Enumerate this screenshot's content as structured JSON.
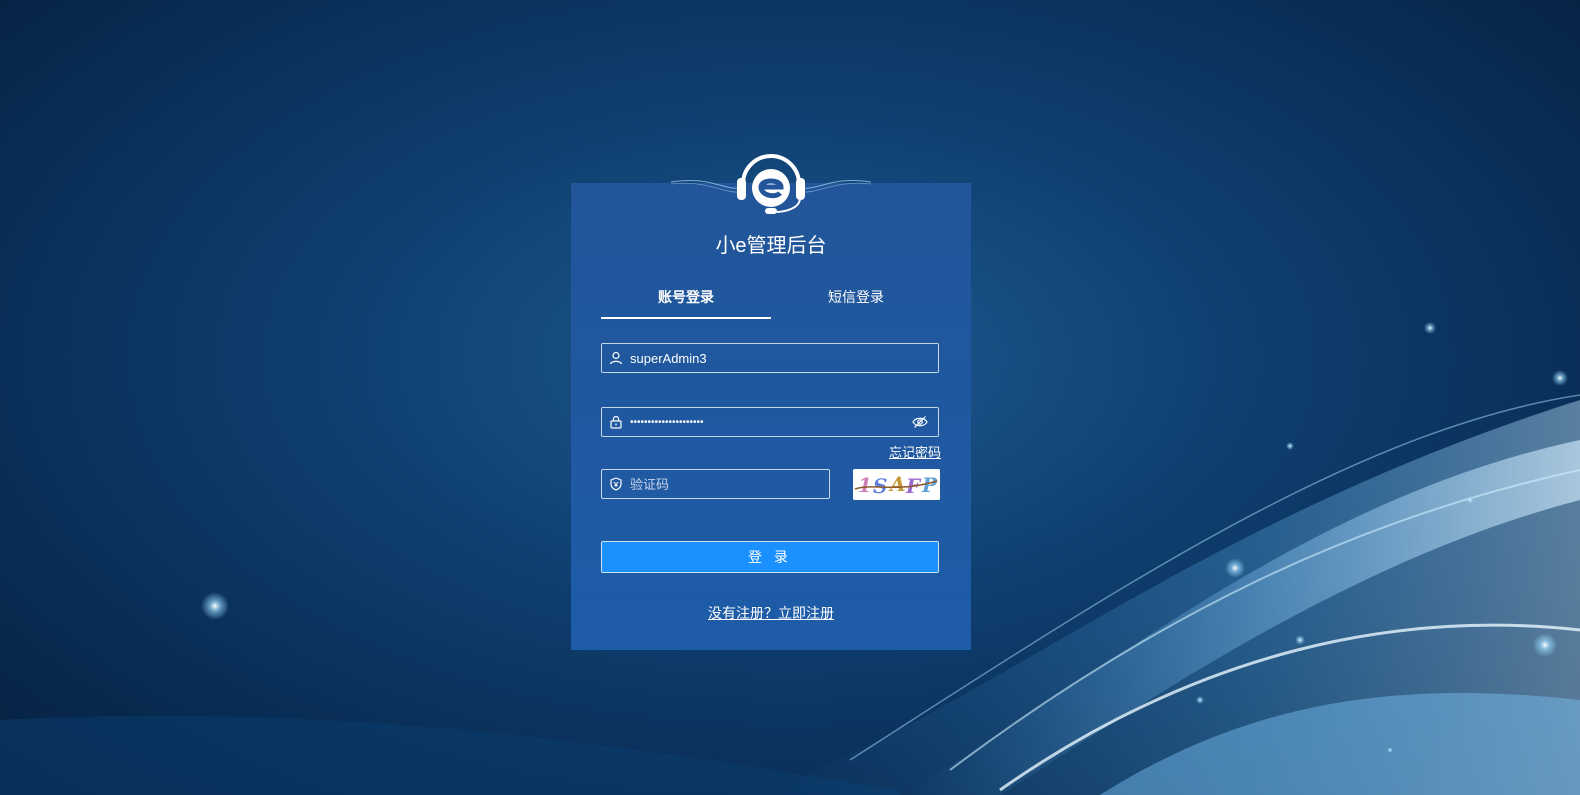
{
  "app": {
    "title": "小e管理后台"
  },
  "tabs": [
    {
      "label": "账号登录",
      "active": true
    },
    {
      "label": "短信登录",
      "active": false
    }
  ],
  "form": {
    "username_value": "superAdmin3",
    "password_value": "•••••••••••••••••••••",
    "captcha_placeholder": "验证码",
    "captcha_text": "1SAFP",
    "forgot_password_label": "忘记密码",
    "login_button_label": "登 录",
    "register_link_label": "没有注册？立即注册"
  },
  "icons": {
    "username": "user-icon",
    "password": "lock-icon",
    "captcha": "shield-icon",
    "toggle_password": "eye-off-icon",
    "logo": "headset-e-logo"
  },
  "colors": {
    "background_dark": "#061f3f",
    "card": "#225599",
    "button": "#1b90ff",
    "text": "#ffffff"
  }
}
